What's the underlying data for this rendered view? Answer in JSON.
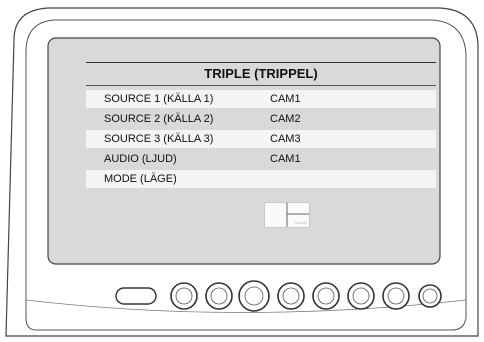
{
  "menu": {
    "title": "TRIPLE (TRIPPEL)",
    "rows": [
      {
        "label": "SOURCE 1 (KÄLLA 1)",
        "value": "CAM1"
      },
      {
        "label": "SOURCE 2 (KÄLLA 2)",
        "value": "CAM2"
      },
      {
        "label": "SOURCE 3 (KÄLLA 3)",
        "value": "CAM3"
      },
      {
        "label": "AUDIO (LJUD)",
        "value": "CAM1"
      },
      {
        "label": "MODE (LÄGE)",
        "value": ""
      }
    ],
    "mode_icon": "triple-split-layout-icon"
  },
  "device": {
    "buttons": [
      "oval-button",
      "round-button",
      "round-button",
      "round-button",
      "round-button",
      "round-button",
      "round-button",
      "round-button"
    ]
  },
  "colors": {
    "screen": "#d9d9d9",
    "row_highlight": "#f4f4f4",
    "frame_stroke": "#444444"
  }
}
